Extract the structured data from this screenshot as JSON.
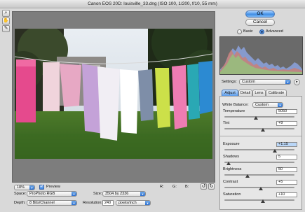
{
  "window": {
    "title": "Canon EOS 20D: louisville_33.dng  (ISO 100, 1/200, f/10, 55 mm)"
  },
  "tools": [
    {
      "name": "zoom-tool-icon",
      "glyph": "🔍"
    },
    {
      "name": "hand-tool-icon",
      "glyph": "✋"
    },
    {
      "name": "eyedropper-tool-icon",
      "glyph": "✎"
    }
  ],
  "bottom": {
    "zoom_value": "18%",
    "preview_label": "Preview",
    "preview_checked": true,
    "rgb_readout": {
      "r_label": "R:",
      "g_label": "G:",
      "b_label": "B:",
      "r": "",
      "g": "",
      "b": ""
    },
    "space_label": "Space:",
    "space_value": "ProPhoto RGB",
    "size_label": "Size:",
    "size_value": "3504 by 2336",
    "depth_label": "Depth:",
    "depth_value": "8 Bits/Channel",
    "resolution_label": "Resolution:",
    "resolution_value": "240",
    "resolution_unit": "pixels/inch"
  },
  "right": {
    "ok_label": "OK",
    "cancel_label": "Cancel",
    "mode_basic": "Basic",
    "mode_advanced": "Advanced",
    "mode_selected": "Advanced",
    "settings_label": "Settings:",
    "settings_value": "Custom",
    "tabs": [
      "Adjust",
      "Detail",
      "Lens",
      "Calibrate"
    ],
    "active_tab": "Adjust",
    "white_balance_label": "White Balance:",
    "white_balance_value": "Custom",
    "sliders_top": [
      {
        "key": "temperature",
        "label": "Temperature",
        "value": "5050",
        "fraction": 0.45
      },
      {
        "key": "tint",
        "label": "Tint",
        "value": "+9",
        "fraction": 0.55
      }
    ],
    "sliders_bottom": [
      {
        "key": "exposure",
        "label": "Exposure",
        "value": "+1.15",
        "fraction": 0.72,
        "highlight": true
      },
      {
        "key": "shadows",
        "label": "Shadows",
        "value": "5",
        "fraction": 0.06
      },
      {
        "key": "brightness",
        "label": "Brightness",
        "value": "50",
        "fraction": 0.33
      },
      {
        "key": "contrast",
        "label": "Contrast",
        "value": "+5",
        "fraction": 0.52
      },
      {
        "key": "saturation",
        "label": "Saturation",
        "value": "+10",
        "fraction": 0.55
      }
    ]
  },
  "colors": {
    "accent": "#3f8de4",
    "highlight_field": "#b9d6f7"
  }
}
